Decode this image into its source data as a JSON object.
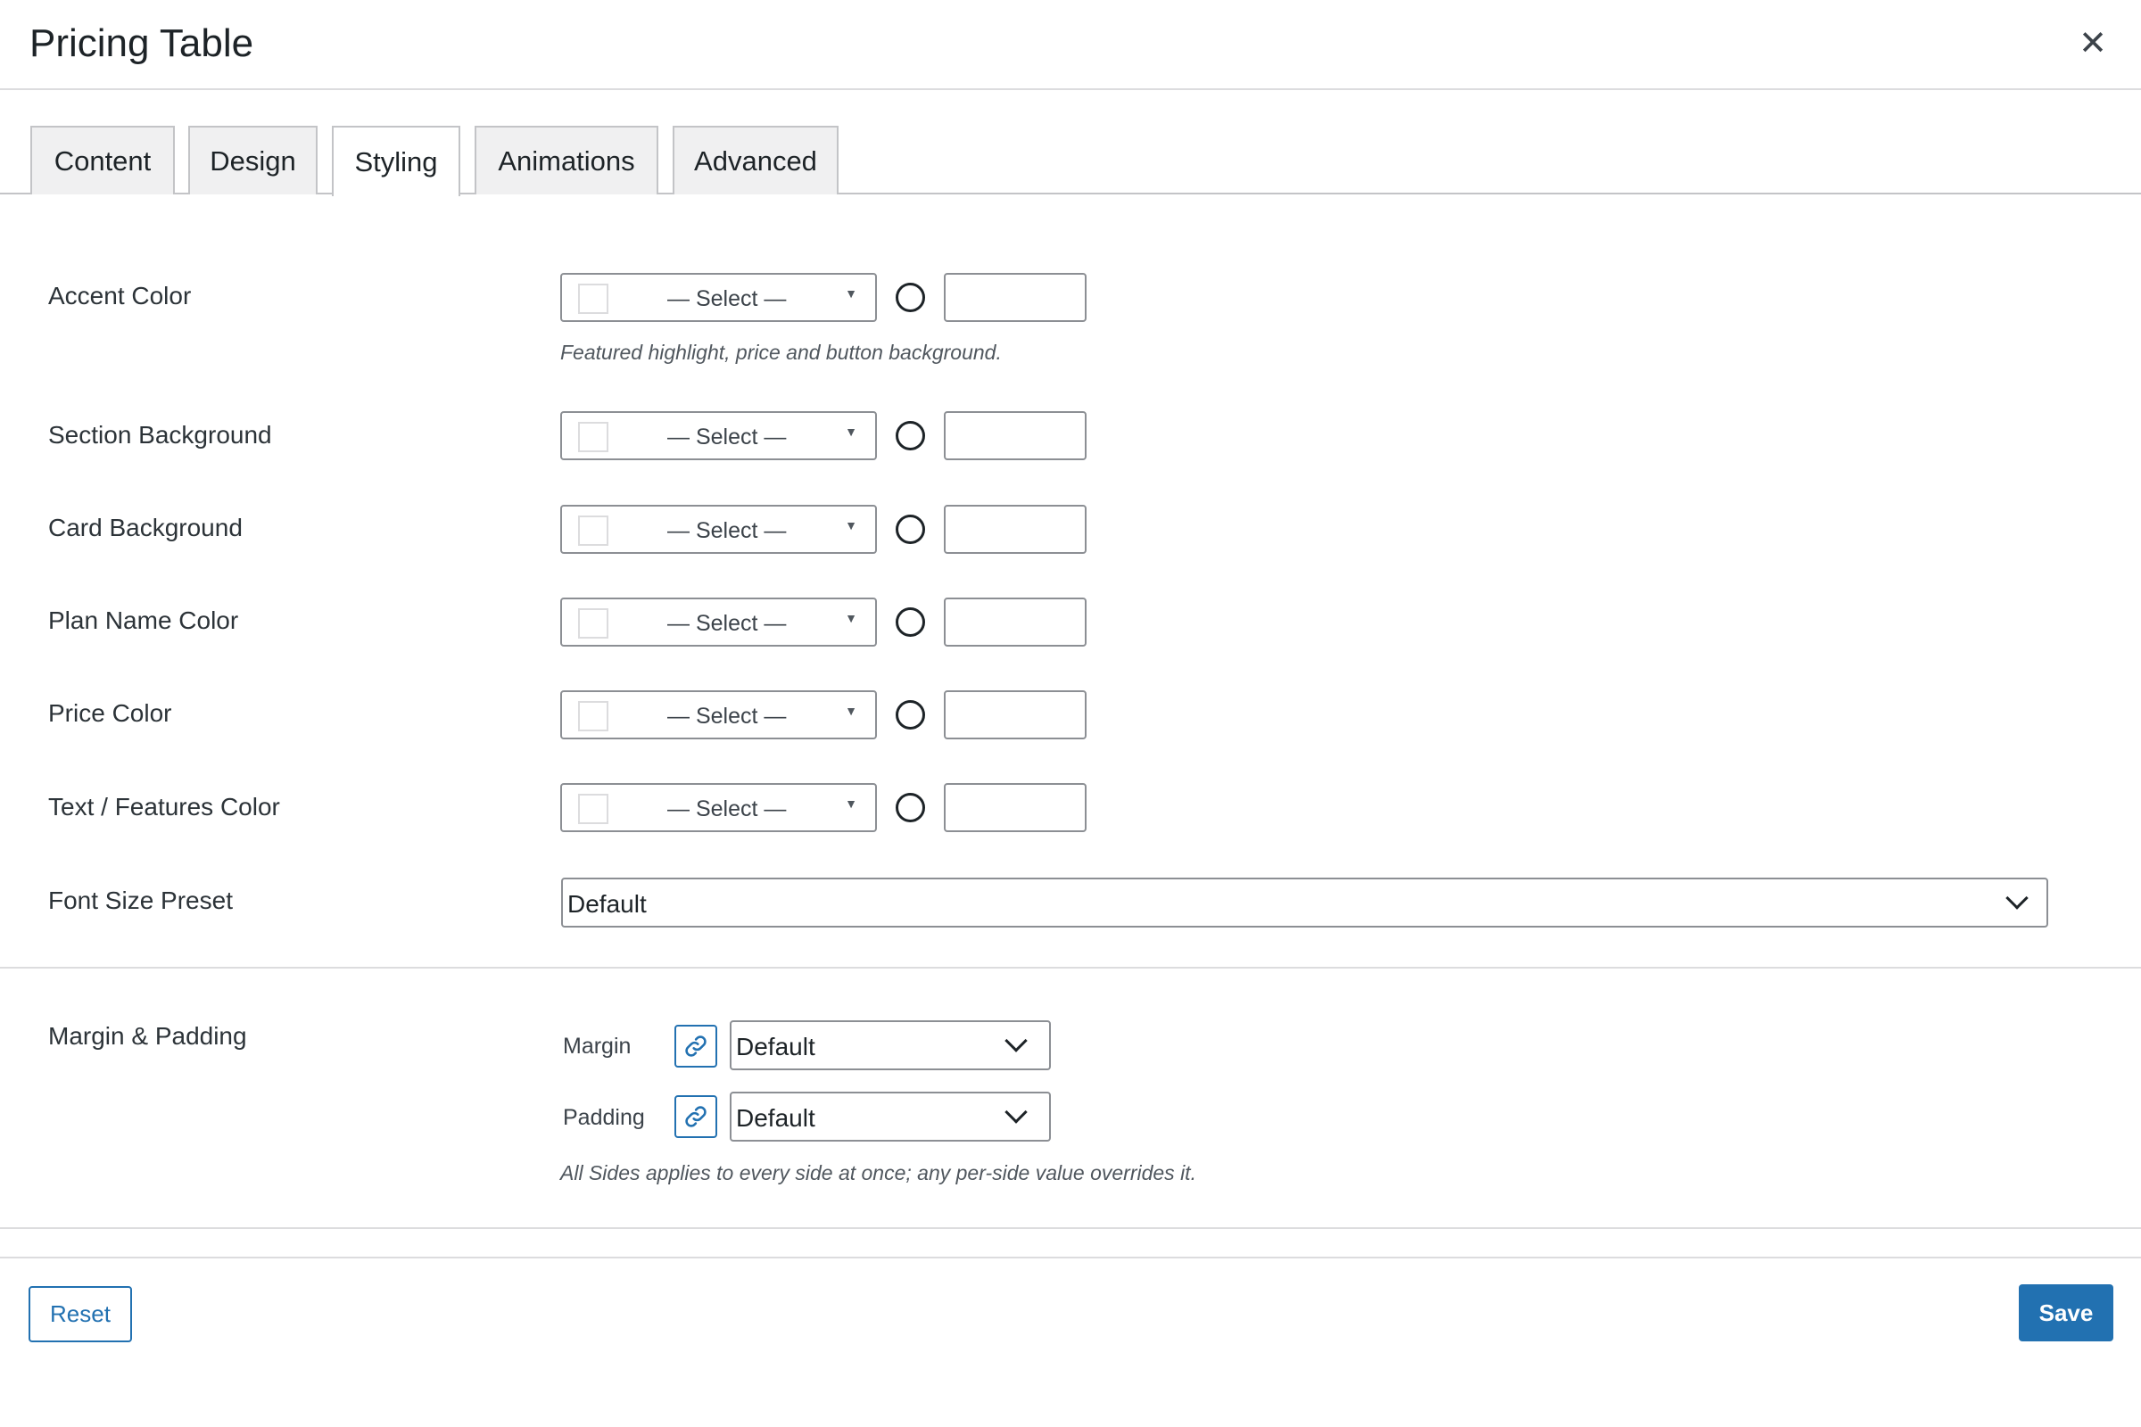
{
  "dialog": {
    "title": "Pricing Table"
  },
  "tabs": [
    {
      "label": "Content",
      "active": false
    },
    {
      "label": "Design",
      "active": false
    },
    {
      "label": "Styling",
      "active": true
    },
    {
      "label": "Animations",
      "active": false
    },
    {
      "label": "Advanced",
      "active": false
    }
  ],
  "fields": {
    "accent_color": {
      "label": "Accent Color",
      "select_text": "— Select —",
      "hex_value": "",
      "description": "Featured highlight, price and button background."
    },
    "section_background": {
      "label": "Section Background",
      "select_text": "— Select —",
      "hex_value": ""
    },
    "card_background": {
      "label": "Card Background",
      "select_text": "— Select —",
      "hex_value": ""
    },
    "plan_name_color": {
      "label": "Plan Name Color",
      "select_text": "— Select —",
      "hex_value": ""
    },
    "price_color": {
      "label": "Price Color",
      "select_text": "— Select —",
      "hex_value": ""
    },
    "text_features_color": {
      "label": "Text / Features Color",
      "select_text": "— Select —",
      "hex_value": ""
    },
    "font_size_preset": {
      "label": "Font Size Preset",
      "value": "Default"
    },
    "margin_padding": {
      "label": "Margin & Padding",
      "margin_label": "Margin",
      "margin_value": "Default",
      "padding_label": "Padding",
      "padding_value": "Default",
      "description": "All Sides applies to every side at once; any per-side value overrides it."
    }
  },
  "footer": {
    "reset_label": "Reset",
    "save_label": "Save"
  },
  "icons": {
    "close": "close-icon",
    "caret": "caret-down-icon",
    "chevron": "chevron-down-icon",
    "link": "link-icon"
  },
  "colors": {
    "accent": "#2271b1",
    "border": "#8c8f94",
    "divider": "#dcdcde"
  }
}
